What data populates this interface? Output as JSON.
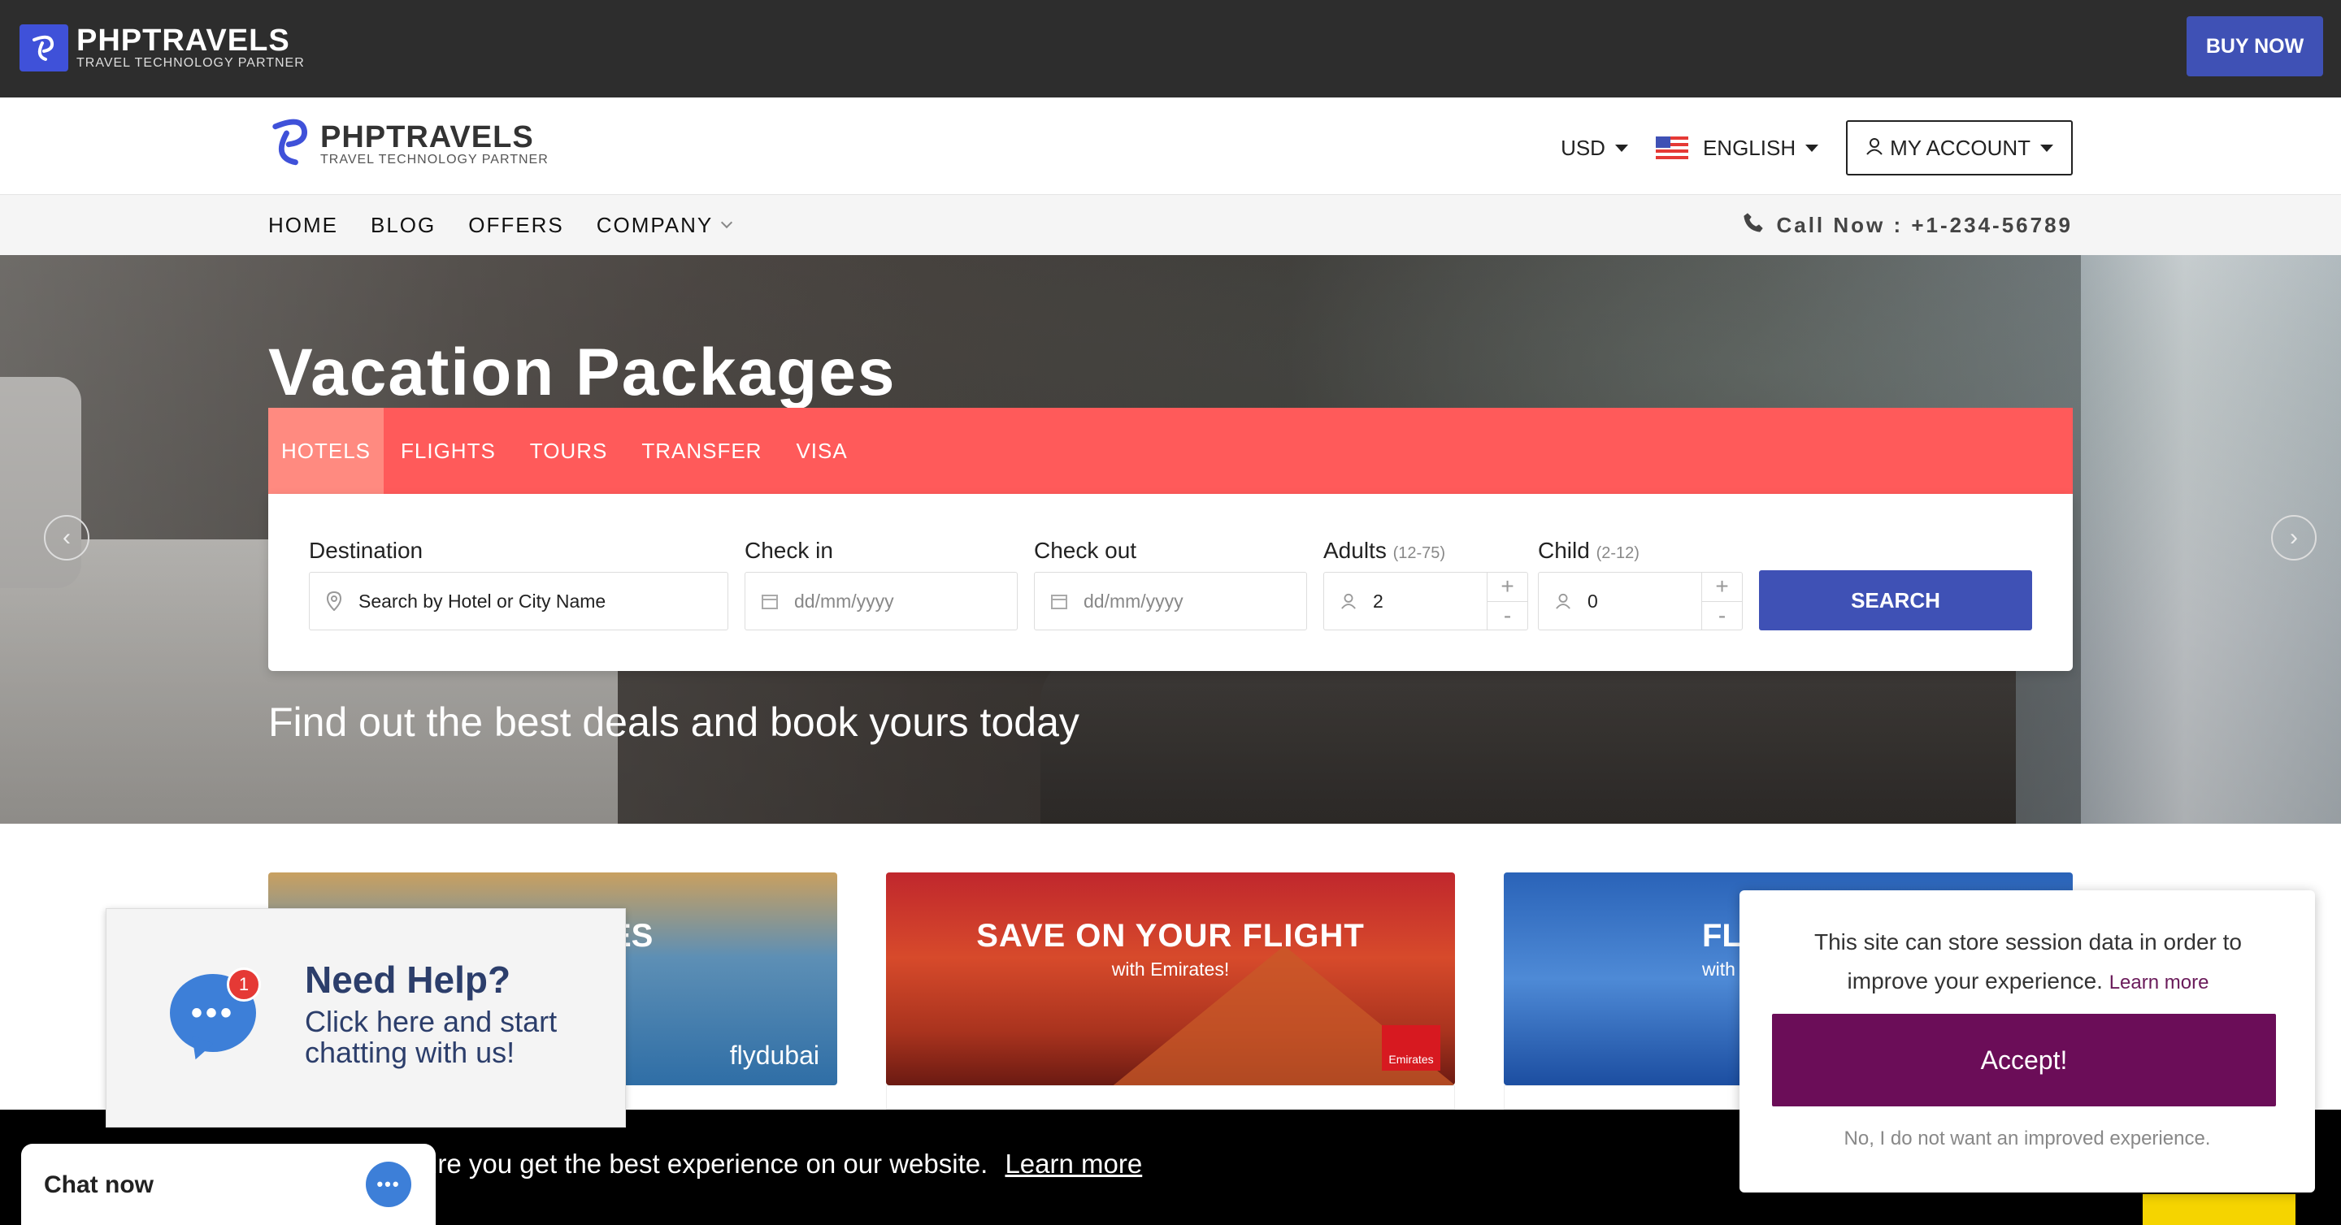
{
  "topbar": {
    "logo_title": "PHPTRAVELS",
    "logo_subtitle": "TRAVEL TECHNOLOGY PARTNER",
    "buy_now": "BUY NOW"
  },
  "header": {
    "logo_title": "PHPTRAVELS",
    "logo_subtitle": "TRAVEL TECHNOLOGY PARTNER",
    "currency": "USD",
    "language": "ENGLISH",
    "account": "MY ACCOUNT"
  },
  "nav": {
    "items": [
      "HOME",
      "BLOG",
      "OFFERS",
      "COMPANY"
    ],
    "call": "Call Now : +1-234-56789"
  },
  "hero": {
    "title": "Vacation Packages",
    "subtitle": "Find out the best deals and book yours today"
  },
  "search": {
    "tabs": [
      "HOTELS",
      "FLIGHTS",
      "TOURS",
      "TRANSFER",
      "VISA"
    ],
    "active_tab": "HOTELS",
    "destination_label": "Destination",
    "destination_placeholder": "Search by Hotel or City Name",
    "checkin_label": "Check in",
    "checkin_placeholder": "dd/mm/yyyy",
    "checkout_label": "Check out",
    "checkout_placeholder": "dd/mm/yyyy",
    "adults_label": "Adults",
    "adults_range": "(12-75)",
    "adults_value": "2",
    "child_label": "Child",
    "child_range": "(2-12)",
    "child_value": "0",
    "search_button": "SEARCH"
  },
  "offers": {
    "card1_partial_title": "ES",
    "card1_brand": "flydubai",
    "card2_title": "SAVE ON YOUR FLIGHT",
    "card2_sub": "with Emirates!",
    "card2_brand": "Emirates",
    "card3_partial_title": "FL",
    "card3_partial_sub": "with"
  },
  "cookiebar": {
    "text": "ure you get the best experience on our website.",
    "link": "Learn more"
  },
  "needhelp": {
    "badge": "1",
    "title": "Need Help?",
    "subtitle": "Click here and start chatting with us!"
  },
  "chat": {
    "label": "Chat now"
  },
  "consent": {
    "text": "This site can store session data in order to improve your experience.",
    "link": "Learn more",
    "accept": "Accept!",
    "decline": "No, I do not want an improved experience."
  },
  "colors": {
    "brand_blue": "#3f51b5",
    "tab_red": "#ff5a5a",
    "accept_purple": "#6b0d58"
  }
}
